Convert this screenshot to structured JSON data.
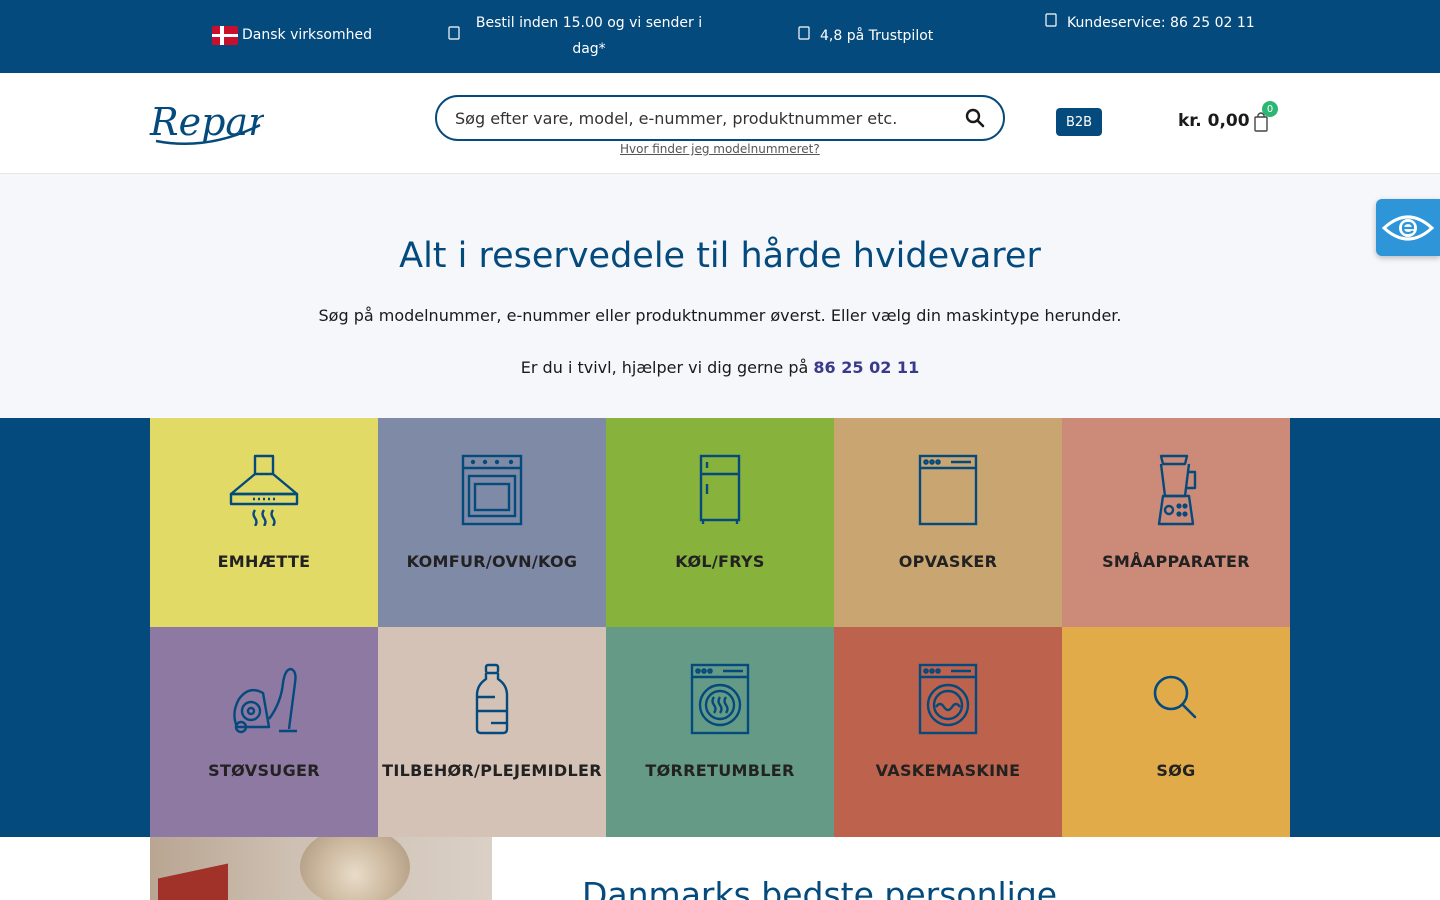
{
  "topbar": {
    "danish_business": "Dansk virksomhed",
    "order_line1": "Bestil inden 15.00 og vi sender i",
    "order_line2": "dag*",
    "trustpilot": "4,8 på Trustpilot",
    "customer_service": "Kundeservice: 86 25 02 11",
    "icons": [
      "dk-flag-icon",
      "truck-icon",
      "star-icon",
      "phone-icon"
    ]
  },
  "header": {
    "logo_text": "Repart",
    "search_placeholder": "Søg efter vare, model, e-nummer, produktnummer etc.",
    "model_help_link": "Hvor finder jeg modelnummeret?",
    "b2b_label": "B2B",
    "cart_total": "kr. 0,00",
    "cart_count": "0"
  },
  "hero": {
    "title": "Alt i reservedele til hårde hvidevarer",
    "subtitle": "Søg på modelnummer, e-nummer eller produktnummer øverst. Eller vælg din maskintype herunder.",
    "help_prefix": "Er du i tvivl, hjælper vi dig gerne på",
    "help_phone": "86 25 02 11"
  },
  "categories": [
    {
      "label": "EMHÆTTE",
      "icon": "range-hood-icon",
      "color": "#e2da66"
    },
    {
      "label": "KOMFUR/OVN/KOG",
      "icon": "oven-icon",
      "color": "#7f8aa6"
    },
    {
      "label": "KØL/FRYS",
      "icon": "fridge-icon",
      "color": "#87b23c"
    },
    {
      "label": "OPVASKER",
      "icon": "dishwasher-icon",
      "color": "#c9a571"
    },
    {
      "label": "SMÅAPPARATER",
      "icon": "blender-icon",
      "color": "#cc8a78"
    },
    {
      "label": "STØVSUGER",
      "icon": "vacuum-cleaner-icon",
      "color": "#8d79a1"
    },
    {
      "label": "TILBEHØR/PLEJEMIDLER",
      "icon": "bottle-icon",
      "color": "#d4c2b6"
    },
    {
      "label": "TØRRETUMBLER",
      "icon": "dryer-icon",
      "color": "#659b86"
    },
    {
      "label": "VASKEMASKINE",
      "icon": "washing-machine-icon",
      "color": "#bd624c"
    },
    {
      "label": "SØG",
      "icon": "search-icon",
      "color": "#e2ab4a"
    }
  ],
  "bottom": {
    "heading": "Danmarks bedste personlige"
  },
  "colors": {
    "brand_blue": "#054a7d",
    "hero_bg": "#f6f7fb",
    "badge_green": "#2bb673",
    "widget_blue": "#2e95d8"
  }
}
